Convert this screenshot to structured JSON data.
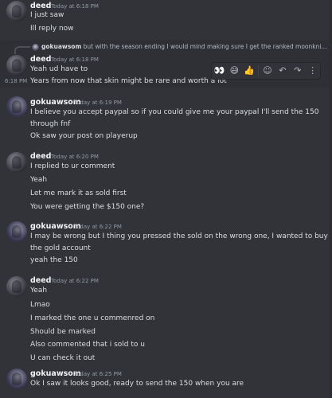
{
  "messages": [
    {
      "author": "deed",
      "timestamp": "Today at 6:18 PM",
      "lines": [
        "I just saw",
        "Ill reply now"
      ]
    },
    {
      "reply": {
        "author": "gokuawsom",
        "text": "but with the season ending I would mind making sure I get the ranked moonkni..."
      },
      "author": "deed",
      "timestamp": "Today at 6:18 PM",
      "lines": [
        "Yeah ud have to",
        "Years from now that skin might be rare and worth a lot"
      ],
      "side_time": "6:18 PM"
    },
    {
      "author": "gokuawsom",
      "timestamp": "Today at 6:19 PM",
      "lines": [
        "I believe you accept paypal so if you could give me your paypal I'll send the 150",
        "through fnf",
        "Ok saw your post on playerup"
      ]
    },
    {
      "author": "deed",
      "timestamp": "Today at 6:20 PM",
      "lines": [
        "I replied to ur comment",
        "Yeah",
        "Let me mark it as sold first",
        "You were getting the $150 one?"
      ]
    },
    {
      "author": "gokuawsom",
      "timestamp": "Today at 6:22 PM",
      "lines": [
        "I may be wrong but I thing you pressed the sold on the wrong one, I wanted to buy",
        "the gold account",
        "yeah the 150"
      ]
    },
    {
      "author": "deed",
      "timestamp": "Today at 6:22 PM",
      "lines": [
        "Yeah",
        "Lmao",
        "I marked the one u commenred on",
        "Should be marked",
        "Also commented that i sold to u",
        "U can check it out"
      ]
    },
    {
      "author": "gokuawsom",
      "timestamp": "Today at 6:25 PM",
      "lines": [
        "Ok I saw it looks good, ready to send the 150 when you are"
      ]
    }
  ],
  "toolbar": {
    "icons": [
      "eyes-emoji",
      "grin-sweat-emoji",
      "thumbs-up-emoji",
      "add-reaction-icon",
      "reply-icon",
      "forward-icon",
      "more-icon"
    ],
    "glyphs": [
      "👀",
      "😅",
      "👍",
      "☺",
      "↶",
      "↷",
      "⋮"
    ]
  }
}
